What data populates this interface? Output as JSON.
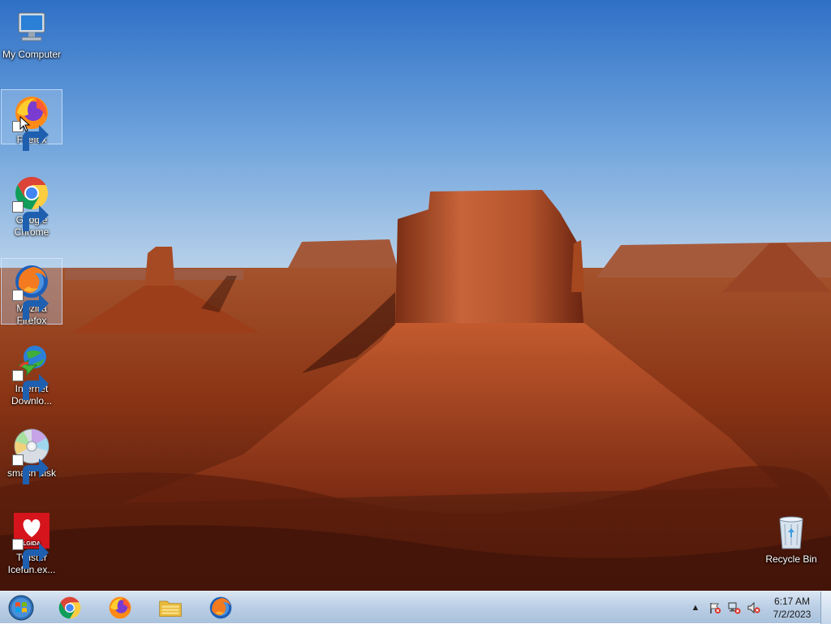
{
  "desktop": {
    "icons": [
      {
        "label": "My Computer",
        "icon": "computer-icon",
        "shortcut": false
      },
      {
        "label": "Firefox",
        "icon": "firefox-icon",
        "shortcut": true
      },
      {
        "label": "Google Chrome",
        "icon": "chrome-icon",
        "shortcut": true
      },
      {
        "label": "Mozilla Firefox",
        "icon": "firefox-classic-icon",
        "shortcut": true
      },
      {
        "label": "Internet Downlo...",
        "icon": "internet-download-manager-icon",
        "shortcut": true
      },
      {
        "label": "smash disk",
        "icon": "disc-icon",
        "shortcut": true
      },
      {
        "label": "Twister Icefun.ex...",
        "icon": "twister-icefun-icon",
        "shortcut": true,
        "badge_text": "LGIDA"
      },
      {
        "label": "Recycle Bin",
        "icon": "recycle-bin-icon",
        "shortcut": false
      }
    ]
  },
  "taskbar": {
    "pinned": [
      "start-orb",
      "chrome-icon",
      "firefox-icon",
      "file-explorer-icon",
      "firefox-classic-icon"
    ],
    "tray": {
      "show_hidden_label": "▲",
      "clock_time": "6:17 AM",
      "clock_date": "7/2/2023"
    }
  },
  "colors": {
    "sky": "#5f9ad9",
    "rock": "#9a3e1a",
    "taskbar": "#bcd0e6",
    "selection": "#b4d2f0"
  }
}
